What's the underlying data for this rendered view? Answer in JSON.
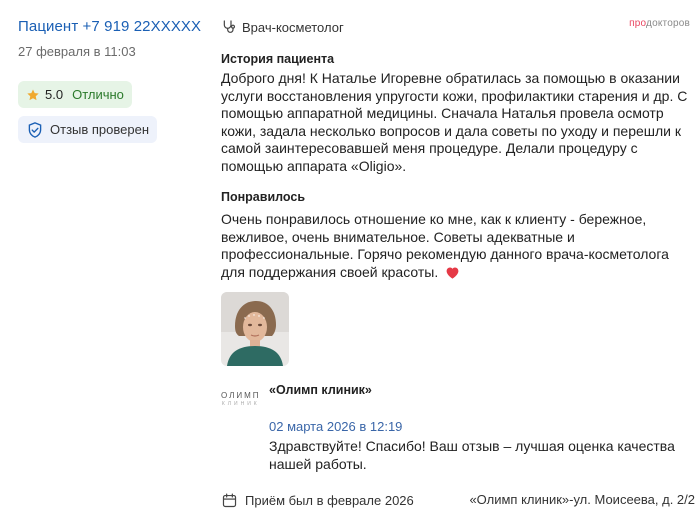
{
  "review": {
    "patient": "Пациент +7 919 22XXXXX",
    "date": "27 февраля в 11:03",
    "rating": "5.0",
    "rating_label": "Отлично",
    "verified_label": "Отзыв проверен",
    "specialty": "Врач-косметолог",
    "brand_accent": "про",
    "brand_rest": "докторов",
    "history_title": "История пациента",
    "history_text": "Доброго дня! К Наталье Игоревне обратилась за помощью в оказании услуги восстановления упругости кожи, профилактики старения и др. С помощью аппаратной медицины. Сначала Наталья провела осмотр кожи, задала несколько вопросов и дала советы по уходу и перешли к самой заинтересовавшей меня процедуре. Делали процедуру с помощью аппарата «Oligio».",
    "liked_title": "Понравилось",
    "liked_text": "Очень понравилось отношение ко мне, как к клиенту - бережное, вежливое, очень внимательное. Советы адекватные и профессиональные. Горячо рекомендую данного врача-косметолога для поддержания своей красоты.",
    "liked_emoji": "heart-emoji"
  },
  "reply": {
    "logo_text": "ОЛИМП",
    "logo_sub": "КЛИНИК",
    "clinic": "«Олимп клиник»",
    "date": "02 марта 2026 в 12:19",
    "text": "Здравствуйте! Спасибо! Ваш отзыв – лучшая оценка качества нашей работы."
  },
  "footer": {
    "visit": "Приём был в феврале  2026",
    "location": "«Олимп клиник»-ул. Моисеева, д. 2/2"
  },
  "colors": {
    "link": "#1a5fb4",
    "rating_bg": "#e6f4e6",
    "verified_bg": "#eef2fb",
    "brand_accent": "#e94560",
    "heart": "#e53946"
  }
}
